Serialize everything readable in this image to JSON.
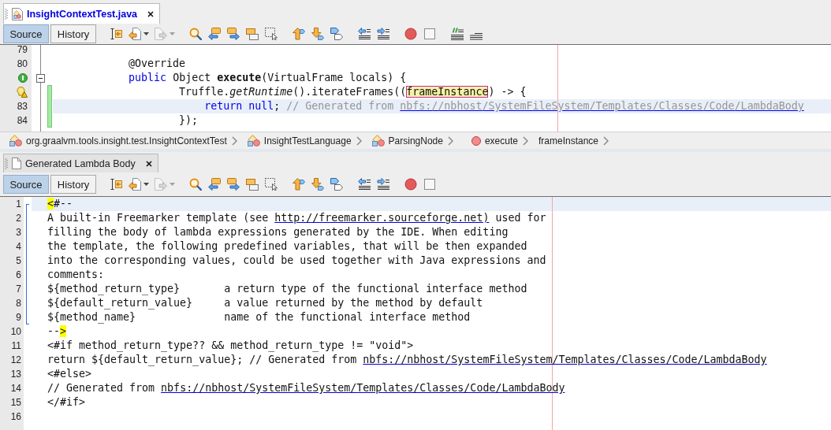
{
  "editors": [
    {
      "tab": {
        "label": "InsightContextTest.java",
        "kind": "java",
        "selected": true
      },
      "view_tabs": [
        {
          "label": "Source",
          "selected": true
        },
        {
          "label": "History",
          "selected": false
        }
      ],
      "toolbar": [
        {
          "kind": "lastedit",
          "dropdown": false,
          "disabled": false
        },
        {
          "kind": "back",
          "dropdown": true,
          "disabled": false
        },
        {
          "kind": "forward",
          "dropdown": true,
          "disabled": true
        },
        {
          "kind": "find",
          "dropdown": false,
          "disabled": false
        },
        {
          "kind": "findprev",
          "dropdown": false,
          "disabled": false
        },
        {
          "kind": "findnext",
          "dropdown": false,
          "disabled": false
        },
        {
          "kind": "highlight",
          "dropdown": false,
          "disabled": false
        },
        {
          "kind": "rectselect",
          "dropdown": false,
          "disabled": false
        },
        {
          "kind": "prevbookmark",
          "dropdown": false,
          "disabled": false
        },
        {
          "kind": "nextbookmark",
          "dropdown": false,
          "disabled": false
        },
        {
          "kind": "togglebookmark",
          "dropdown": false,
          "disabled": false
        },
        {
          "kind": "shiftleft",
          "dropdown": false,
          "disabled": false
        },
        {
          "kind": "shiftright",
          "dropdown": false,
          "disabled": false
        },
        {
          "kind": "record",
          "dropdown": false,
          "disabled": false
        },
        {
          "kind": "stop",
          "dropdown": false,
          "disabled": false
        },
        {
          "kind": "comment",
          "dropdown": false,
          "disabled": false
        },
        {
          "kind": "uncomment",
          "dropdown": false,
          "disabled": false
        }
      ],
      "lines": [
        {
          "number": "79",
          "override_marker": false,
          "hint_marker": false,
          "current": false,
          "changed": false,
          "fold_guide": true,
          "fold_box": false
        },
        {
          "number": "80",
          "override_marker": false,
          "hint_marker": false,
          "current": false,
          "changed": false,
          "fold_guide": true,
          "fold_box": false,
          "tokens": [
            {
              "text": "            @Override",
              "kind": "plain"
            }
          ]
        },
        {
          "override_marker": true,
          "hint_marker": false,
          "current": false,
          "changed": false,
          "fold_guide": true,
          "fold_box": true,
          "tokens": [
            {
              "text": "            public",
              "kind": "keyword"
            },
            {
              "text": " Object ",
              "kind": "plain"
            },
            {
              "text": "execute",
              "kind": "bold"
            },
            {
              "text": "(VirtualFrame locals) {",
              "kind": "plain"
            }
          ]
        },
        {
          "override_marker": false,
          "hint_marker": true,
          "current": false,
          "changed": true,
          "fold_guide": true,
          "fold_box": false,
          "tokens": [
            {
              "text": "                    Truffle.",
              "kind": "plain"
            },
            {
              "text": "getRuntime",
              "kind": "italic"
            },
            {
              "text": "().iterateFrames((",
              "kind": "plain"
            },
            {
              "text": "frameInstance",
              "kind": "mark"
            },
            {
              "text": ") -> {",
              "kind": "plain"
            }
          ]
        },
        {
          "number": "83",
          "override_marker": false,
          "hint_marker": false,
          "current": true,
          "changed": true,
          "fold_guide": true,
          "fold_box": false,
          "tokens": [
            {
              "text": "                        return null",
              "kind": "keyword"
            },
            {
              "text": "; ",
              "kind": "plain"
            },
            {
              "text": "// Generated from ",
              "kind": "comment"
            },
            {
              "text": "nbfs://nbhost/SystemFileSystem/Templates/Classes/Code/LambdaBody",
              "kind": "comment-link"
            }
          ]
        },
        {
          "number": "84",
          "override_marker": false,
          "hint_marker": false,
          "current": false,
          "changed": true,
          "fold_guide": true,
          "fold_box": false,
          "tokens": [
            {
              "text": "                    });",
              "kind": "plain"
            }
          ]
        }
      ],
      "breadcrumbs": [
        {
          "label": "org.graalvm.tools.insight.test.InsightContextTest",
          "kind": "class"
        },
        {
          "label": "InsightTestLanguage",
          "kind": "class"
        },
        {
          "label": "ParsingNode",
          "kind": "class"
        },
        {
          "label": "execute",
          "kind": "method"
        },
        {
          "label": "frameInstance",
          "kind": "variable"
        }
      ]
    },
    {
      "tab": {
        "label": "Generated Lambda Body",
        "kind": "template",
        "selected": false
      },
      "view_tabs": [
        {
          "label": "Source",
          "selected": true
        },
        {
          "label": "History",
          "selected": false
        }
      ],
      "toolbar": [
        {
          "kind": "lastedit",
          "dropdown": false,
          "disabled": false
        },
        {
          "kind": "back",
          "dropdown": true,
          "disabled": false
        },
        {
          "kind": "forward",
          "dropdown": true,
          "disabled": true
        },
        {
          "kind": "find",
          "dropdown": false,
          "disabled": false
        },
        {
          "kind": "findprev",
          "dropdown": false,
          "disabled": false
        },
        {
          "kind": "findnext",
          "dropdown": false,
          "disabled": false
        },
        {
          "kind": "highlight",
          "dropdown": false,
          "disabled": false
        },
        {
          "kind": "rectselect",
          "dropdown": false,
          "disabled": false
        },
        {
          "kind": "prevbookmark",
          "dropdown": false,
          "disabled": false
        },
        {
          "kind": "nextbookmark",
          "dropdown": false,
          "disabled": false
        },
        {
          "kind": "togglebookmark",
          "dropdown": false,
          "disabled": false
        },
        {
          "kind": "shiftleft",
          "dropdown": false,
          "disabled": false
        },
        {
          "kind": "shiftright",
          "dropdown": false,
          "disabled": false
        },
        {
          "kind": "record",
          "dropdown": false,
          "disabled": false
        },
        {
          "kind": "stop",
          "dropdown": false,
          "disabled": false
        }
      ],
      "lines": [
        {
          "number": "1",
          "current": true,
          "fold_start": true,
          "fold_end": false,
          "tokens": [
            {
              "text": "<",
              "kind": "match"
            },
            {
              "text": "#--",
              "kind": "plain"
            }
          ]
        },
        {
          "number": "2",
          "current": false,
          "fold_start": false,
          "fold_end": false,
          "tokens": [
            {
              "text": "A built-in Freemarker template (see ",
              "kind": "plain"
            },
            {
              "text": "http://freemarker.sourceforge.net)",
              "kind": "link"
            },
            {
              "text": " used for",
              "kind": "plain"
            }
          ]
        },
        {
          "number": "3",
          "current": false,
          "fold_start": false,
          "fold_end": false,
          "tokens": [
            {
              "text": "filling the body of lambda expressions generated by the IDE. When editing",
              "kind": "plain"
            }
          ]
        },
        {
          "number": "4",
          "current": false,
          "fold_start": false,
          "fold_end": false,
          "tokens": [
            {
              "text": "the template, the following predefined variables, that will be then expanded",
              "kind": "plain"
            }
          ]
        },
        {
          "number": "5",
          "current": false,
          "fold_start": false,
          "fold_end": false,
          "tokens": [
            {
              "text": "into the corresponding values, could be used together with Java expressions and",
              "kind": "plain"
            }
          ]
        },
        {
          "number": "6",
          "current": false,
          "fold_start": false,
          "fold_end": false,
          "tokens": [
            {
              "text": "comments:",
              "kind": "plain"
            }
          ]
        },
        {
          "number": "7",
          "current": false,
          "fold_start": false,
          "fold_end": false,
          "tokens": [
            {
              "text": "${method_return_type}       a return type of the functional interface method",
              "kind": "plain"
            }
          ]
        },
        {
          "number": "8",
          "current": false,
          "fold_start": false,
          "fold_end": false,
          "tokens": [
            {
              "text": "${default_return_value}     a value returned by the method by default",
              "kind": "plain"
            }
          ]
        },
        {
          "number": "9",
          "current": false,
          "fold_start": false,
          "fold_end": true,
          "tokens": [
            {
              "text": "${method_name}              name of the functional interface method",
              "kind": "plain"
            }
          ]
        },
        {
          "number": "10",
          "current": false,
          "fold_start": false,
          "fold_end": false,
          "tokens": [
            {
              "text": "--",
              "kind": "plain"
            },
            {
              "text": ">",
              "kind": "match"
            }
          ]
        },
        {
          "number": "11",
          "current": false,
          "fold_start": false,
          "fold_end": false,
          "tokens": [
            {
              "text": "<#if method_return_type?? && method_return_type != \"void\">",
              "kind": "plain"
            }
          ]
        },
        {
          "number": "12",
          "current": false,
          "fold_start": false,
          "fold_end": false,
          "tokens": [
            {
              "text": "return ${default_return_value}; // Generated from ",
              "kind": "plain"
            },
            {
              "text": "nbfs://nbhost/SystemFileSystem/Templates/Classes/Code/LambdaBody",
              "kind": "link"
            }
          ]
        },
        {
          "number": "13",
          "current": false,
          "fold_start": false,
          "fold_end": false,
          "tokens": [
            {
              "text": "<#else>",
              "kind": "plain"
            }
          ]
        },
        {
          "number": "14",
          "current": false,
          "fold_start": false,
          "fold_end": false,
          "tokens": [
            {
              "text": "// Generated from ",
              "kind": "plain"
            },
            {
              "text": "nbfs://nbhost/SystemFileSystem/Templates/Classes/Code/LambdaBody",
              "kind": "link"
            }
          ]
        },
        {
          "number": "15",
          "current": false,
          "fold_start": false,
          "fold_end": false,
          "tokens": [
            {
              "text": "</#if>",
              "kind": "plain"
            }
          ]
        },
        {
          "number": "16",
          "current": false,
          "fold_start": false,
          "fold_end": false
        }
      ]
    }
  ]
}
